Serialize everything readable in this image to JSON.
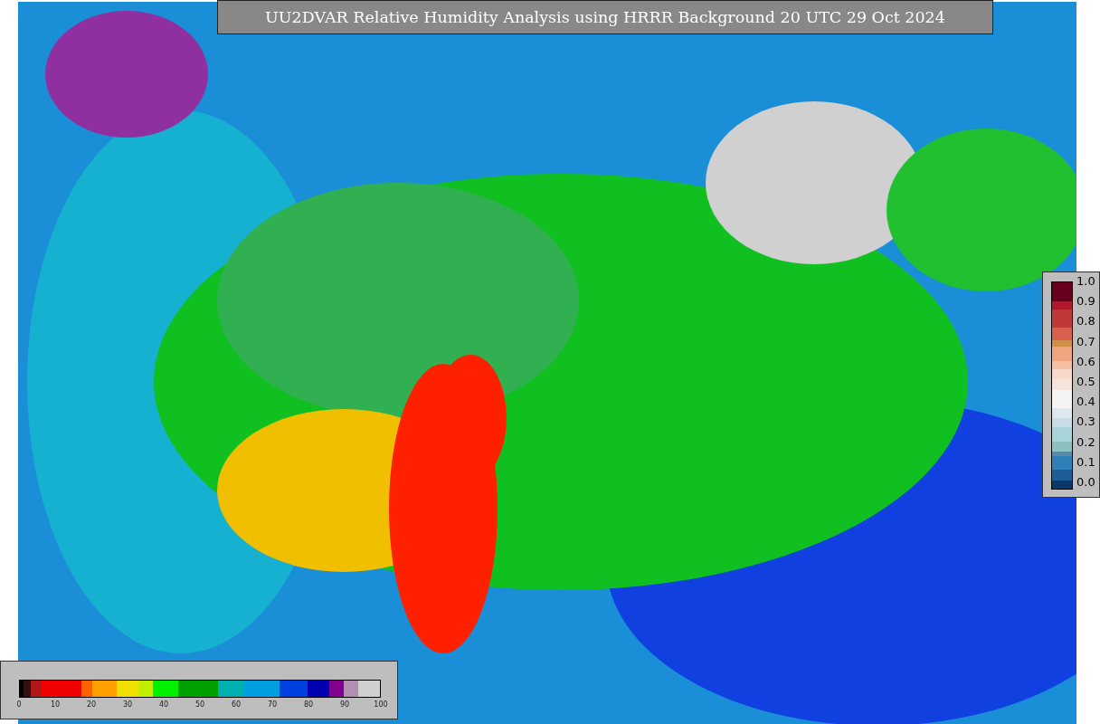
{
  "title": "UU2DVAR Relative Humidity Analysis using HRRR Background 20 UTC 29 Oct 2024",
  "observation_scale": {
    "labels": [
      "1.0",
      "0.9",
      "0.8",
      "0.7",
      "0.6",
      "0.5",
      "0.4",
      "0.3",
      "0.2",
      "0.1",
      "0.0"
    ]
  },
  "humidity_scale": {
    "labels": [
      "0",
      "10",
      "20",
      "30",
      "40",
      "50",
      "60",
      "70",
      "80",
      "90",
      "100"
    ]
  }
}
